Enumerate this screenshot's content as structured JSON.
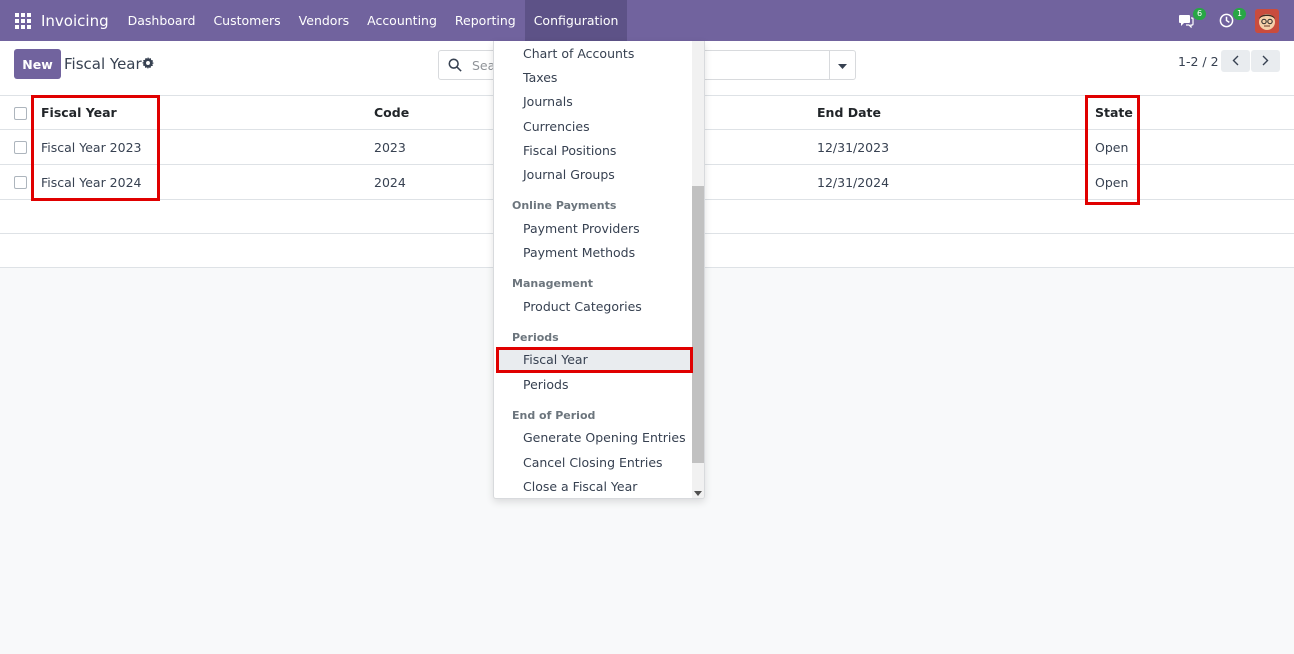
{
  "navbar": {
    "app_name": "Invoicing",
    "menu": [
      "Dashboard",
      "Customers",
      "Vendors",
      "Accounting",
      "Reporting",
      "Configuration"
    ],
    "active_menu": "Configuration",
    "messages_badge": "6",
    "activities_badge": "1"
  },
  "control": {
    "new_label": "New",
    "title": "Fiscal Year",
    "search_placeholder": "Sea",
    "pager": "1-2 / 2"
  },
  "list": {
    "columns": [
      "Fiscal Year",
      "Code",
      "End Date",
      "State"
    ],
    "rows": [
      {
        "name": "Fiscal Year 2023",
        "code": "2023",
        "end_date": "12/31/2023",
        "state": "Open"
      },
      {
        "name": "Fiscal Year 2024",
        "code": "2024",
        "end_date": "12/31/2024",
        "state": "Open"
      }
    ]
  },
  "dropdown": {
    "accounting_items": [
      "Chart of Accounts",
      "Taxes",
      "Journals",
      "Currencies",
      "Fiscal Positions",
      "Journal Groups"
    ],
    "online_payments_header": "Online Payments",
    "online_payments_items": [
      "Payment Providers",
      "Payment Methods"
    ],
    "management_header": "Management",
    "management_items": [
      "Product Categories"
    ],
    "periods_header": "Periods",
    "periods_items": [
      "Fiscal Year",
      "Periods"
    ],
    "end_of_period_header": "End of Period",
    "end_of_period_items": [
      "Generate Opening Entries",
      "Cancel Closing Entries",
      "Close a Fiscal Year"
    ]
  },
  "colors": {
    "navbar": "#71639e",
    "highlight": "#e00000",
    "badge": "#28a745"
  }
}
